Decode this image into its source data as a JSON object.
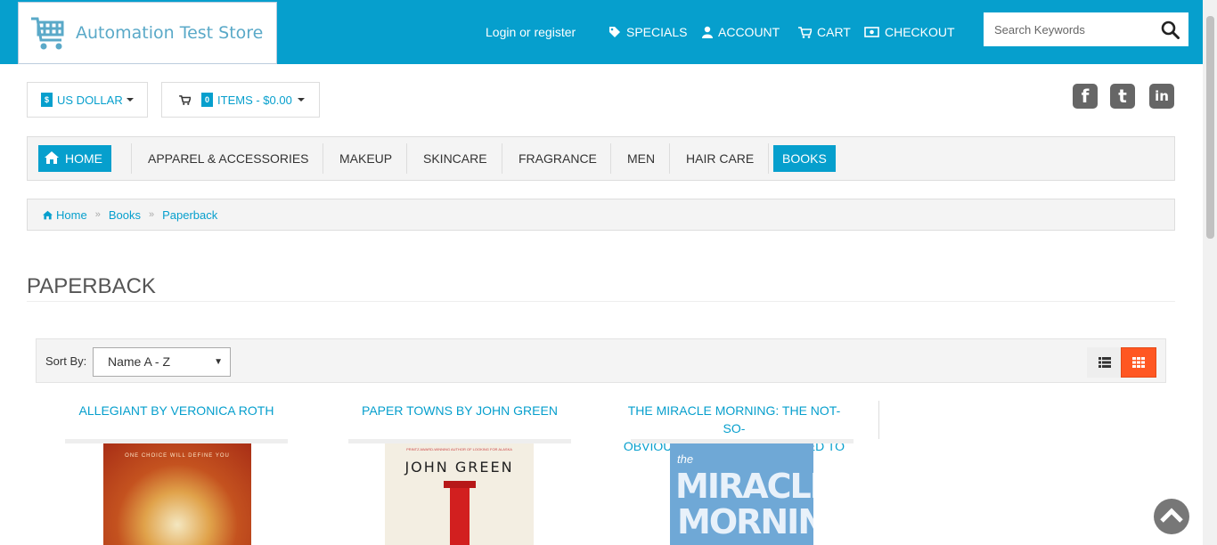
{
  "header": {
    "logo_text": "Automation Test Store",
    "login_text": "Login or register",
    "links": [
      {
        "label": "SPECIALS",
        "icon": "tag-icon"
      },
      {
        "label": "ACCOUNT",
        "icon": "user-icon"
      },
      {
        "label": "CART",
        "icon": "cart-icon"
      },
      {
        "label": "CHECKOUT",
        "icon": "money-icon"
      }
    ],
    "search_placeholder": "Search Keywords"
  },
  "toolbar": {
    "currency_badge": "$",
    "currency_label": "US DOLLAR",
    "cart_count": "0",
    "cart_label": "ITEMS - $0.00"
  },
  "social": [
    "f",
    "t",
    "in"
  ],
  "nav": {
    "items": [
      "HOME",
      "APPAREL & ACCESSORIES",
      "MAKEUP",
      "SKINCARE",
      "FRAGRANCE",
      "MEN",
      "HAIR CARE",
      "BOOKS"
    ],
    "active": "BOOKS"
  },
  "breadcrumb": [
    "Home",
    "Books",
    "Paperback"
  ],
  "page_title": "PAPERBACK",
  "sort": {
    "label": "Sort By:",
    "selected": "Name A - Z"
  },
  "products": [
    {
      "title": "ALLEGIANT BY VERONICA ROTH",
      "cover_top": "ONE CHOICE WILL DEFINE YOU"
    },
    {
      "title": "PAPER TOWNS BY JOHN GREEN",
      "cover_top": "PRINTZ AWARD-WINNING AUTHOR OF LOOKING FOR ALASKA",
      "cover_author": "JOHN GREEN"
    },
    {
      "title_line1": "THE MIRACLE MORNING: THE NOT-SO-",
      "title_line2": "OBVIOUS SECRET GUARANTEED TO",
      "cover_small": "the",
      "cover_big1": "MIRACLE",
      "cover_big2": "MORNING"
    }
  ],
  "colors": {
    "brand": "#069fcd",
    "grid_active": "#ff5722"
  }
}
